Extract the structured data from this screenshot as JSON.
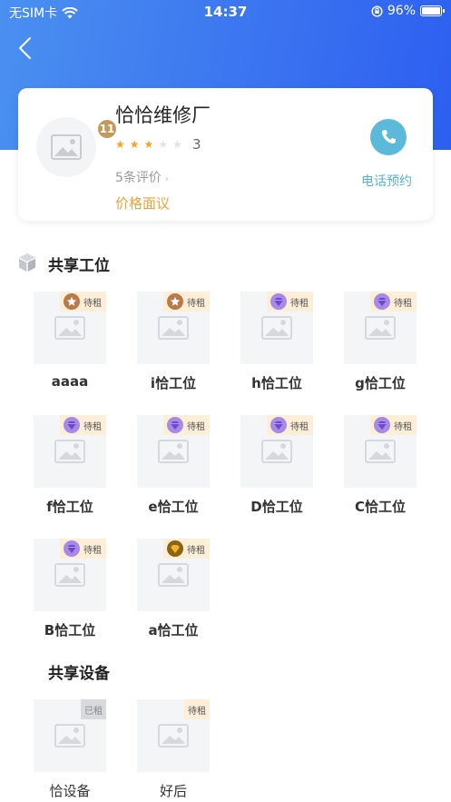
{
  "status_bar": {
    "carrier": "无SIM卡",
    "time": "14:37",
    "battery": "96%"
  },
  "colors": {
    "header_gradient_start": "#4a90f0",
    "header_gradient_end": "#2c5ff0",
    "price": "#e8a43a",
    "phone": "#5bb9d9",
    "star_on": "#f5a623",
    "tag_bg": "#fdeed8"
  },
  "shop": {
    "name": "恰恰维修厂",
    "level": "11",
    "rating": "3",
    "stars_filled": 3,
    "stars_total": 5,
    "reviews": "5条评价",
    "price": "价格面议",
    "phone_label": "电话预约"
  },
  "workstations": {
    "title": "共享工位",
    "items": [
      {
        "label": "aaaa",
        "tag": "待租",
        "badge": "bronze-star"
      },
      {
        "label": "i恰工位",
        "tag": "待租",
        "badge": "bronze-star"
      },
      {
        "label": "h恰工位",
        "tag": "待租",
        "badge": "purple-diamond"
      },
      {
        "label": "g恰工位",
        "tag": "待租",
        "badge": "purple-diamond"
      },
      {
        "label": "f恰工位",
        "tag": "待租",
        "badge": "purple-diamond"
      },
      {
        "label": "e恰工位",
        "tag": "待租",
        "badge": "purple-diamond"
      },
      {
        "label": "D恰工位",
        "tag": "待租",
        "badge": "purple-diamond"
      },
      {
        "label": "C恰工位",
        "tag": "待租",
        "badge": "purple-diamond"
      },
      {
        "label": "B恰工位",
        "tag": "待租",
        "badge": "purple-diamond"
      },
      {
        "label": "a恰工位",
        "tag": "待租",
        "badge": "gold-diamond"
      }
    ]
  },
  "equipment": {
    "title": "共享设备",
    "items": [
      {
        "label": "恰设备",
        "tag": "已租"
      },
      {
        "label": "好后",
        "tag": "待租"
      }
    ]
  }
}
